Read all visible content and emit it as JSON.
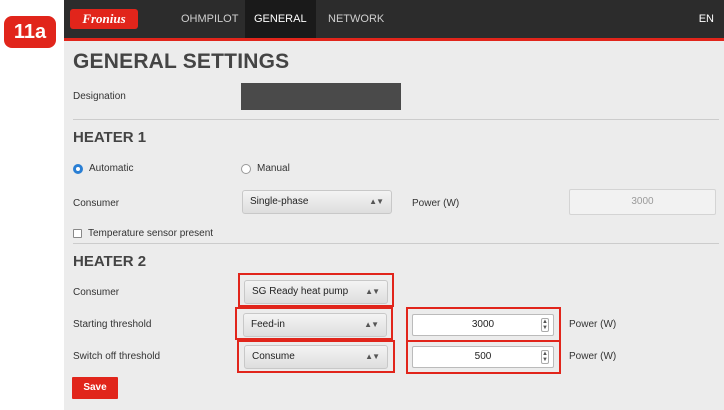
{
  "step_badge": "11a",
  "header": {
    "logo_text": "Fronius",
    "tabs": [
      {
        "label": "OHMPILOT",
        "active": false
      },
      {
        "label": "GENERAL",
        "active": true
      },
      {
        "label": "NETWORK",
        "active": false
      }
    ],
    "language": "EN"
  },
  "page_title": "GENERAL SETTINGS",
  "designation": {
    "label": "Designation",
    "value": ""
  },
  "heater1": {
    "title": "HEATER 1",
    "mode_options": [
      {
        "label": "Automatic",
        "checked": true
      },
      {
        "label": "Manual",
        "checked": false
      }
    ],
    "consumer_label": "Consumer",
    "consumer_value": "Single-phase",
    "power_label": "Power (W)",
    "power_value": "3000",
    "temp_sensor_label": "Temperature sensor present",
    "temp_sensor_checked": false
  },
  "heater2": {
    "title": "HEATER 2",
    "consumer_label": "Consumer",
    "consumer_value": "SG Ready heat pump",
    "starting_label": "Starting threshold",
    "starting_mode": "Feed-in",
    "starting_value": "3000",
    "starting_unit": "Power (W)",
    "switchoff_label": "Switch off threshold",
    "switchoff_mode": "Consume",
    "switchoff_value": "500",
    "switchoff_unit": "Power (W)"
  },
  "save_label": "Save",
  "colors": {
    "accent": "#e1251b",
    "topbar": "#2c2c2c",
    "panel": "#ececec",
    "radio_checked": "#2a7fd4"
  },
  "icons": {
    "select_arrows": "updown-arrows-icon",
    "spinner": "number-spinner-icon"
  }
}
